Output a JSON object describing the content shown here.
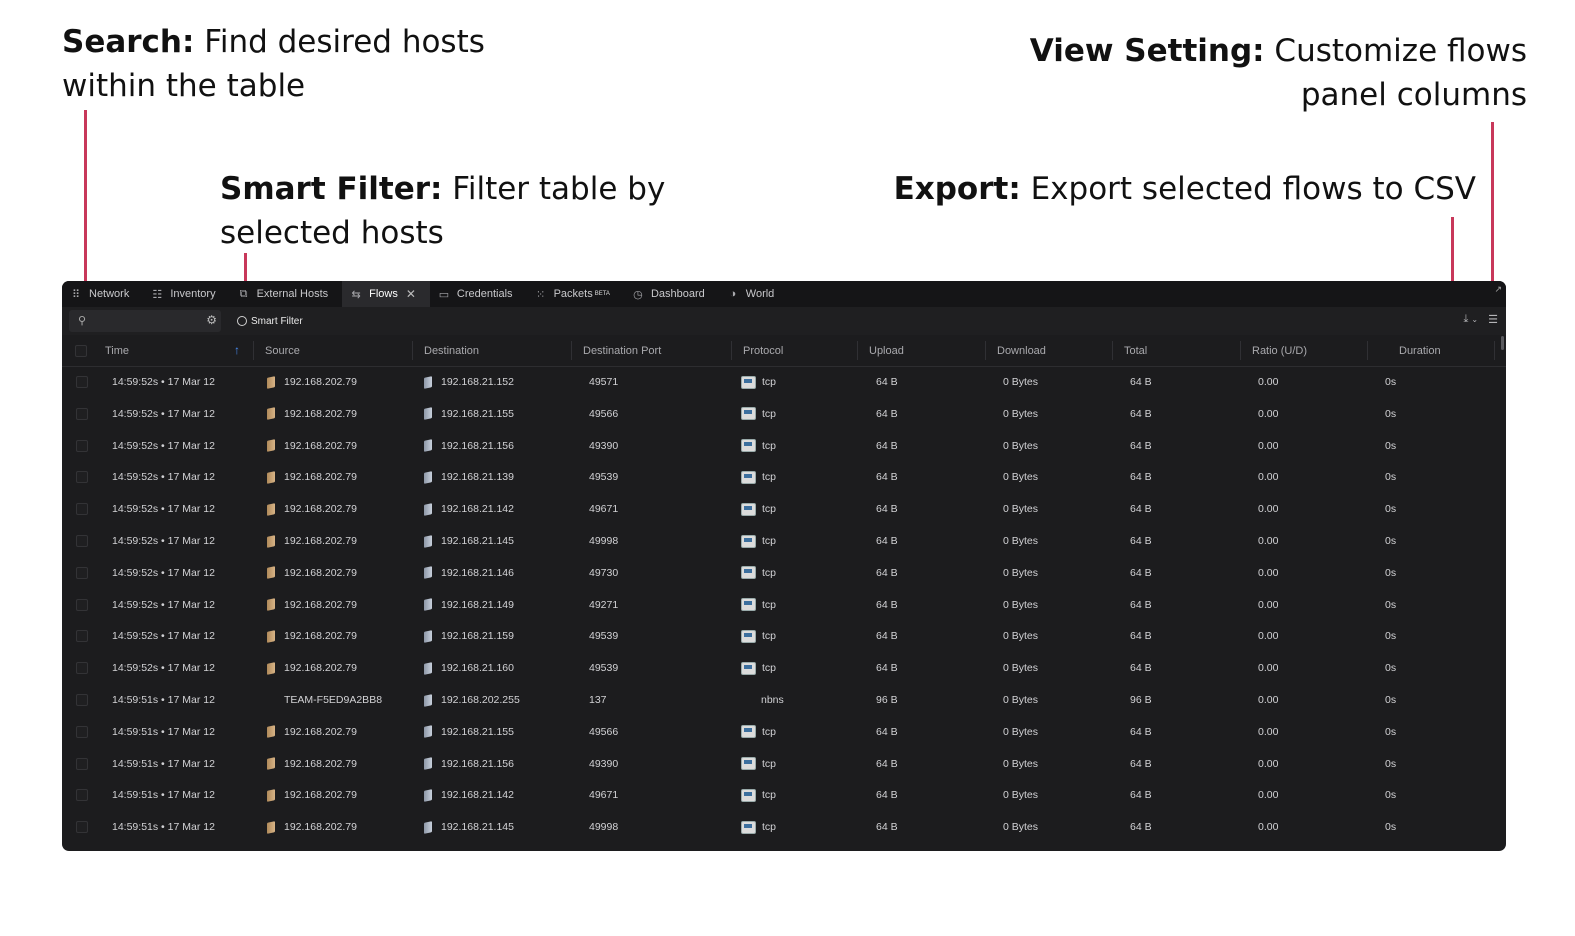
{
  "callouts": {
    "search": {
      "title": "Search:",
      "text": "Find desired hosts",
      "text2": "within the table"
    },
    "smart_filter": {
      "title": "Smart Filter:",
      "text": "Filter table by",
      "text2": "selected hosts"
    },
    "view_setting": {
      "title": "View Setting:",
      "text": "Customize flows",
      "text2": "panel columns"
    },
    "export": {
      "title": "Export:",
      "text": "Export selected flows to CSV"
    }
  },
  "tabs": [
    {
      "label": "Network",
      "icon": "network-icon",
      "glyph": "⠿"
    },
    {
      "label": "Inventory",
      "icon": "inventory-icon",
      "glyph": "☷"
    },
    {
      "label": "External Hosts",
      "icon": "external-hosts-icon",
      "glyph": "⧉"
    },
    {
      "label": "Flows",
      "icon": "flows-icon",
      "glyph": "⇆",
      "active": true
    },
    {
      "label": "Credentials",
      "icon": "credentials-icon",
      "glyph": "▭"
    },
    {
      "label": "Packets",
      "icon": "packets-icon",
      "glyph": "⁙",
      "badge": "BETA"
    },
    {
      "label": "Dashboard",
      "icon": "dashboard-icon",
      "glyph": "◷"
    },
    {
      "label": "World",
      "icon": "world-icon",
      "glyph": "◑"
    }
  ],
  "toolbar": {
    "search_placeholder": "",
    "smart_filter_label": "Smart Filter"
  },
  "columns": [
    "Time",
    "Source",
    "Destination",
    "Destination Port",
    "Protocol",
    "Upload",
    "Download",
    "Total",
    "Ratio (U/D)",
    "Duration"
  ],
  "rows": [
    {
      "time": "14:59:52s • 17 Mar 12",
      "source": "192.168.202.79",
      "destination": "192.168.21.152",
      "port": "49571",
      "protocol": "tcp",
      "upload": "64 B",
      "download": "0 Bytes",
      "total": "64 B",
      "ratio": "0.00",
      "duration": "0s"
    },
    {
      "time": "14:59:52s • 17 Mar 12",
      "source": "192.168.202.79",
      "destination": "192.168.21.155",
      "port": "49566",
      "protocol": "tcp",
      "upload": "64 B",
      "download": "0 Bytes",
      "total": "64 B",
      "ratio": "0.00",
      "duration": "0s"
    },
    {
      "time": "14:59:52s • 17 Mar 12",
      "source": "192.168.202.79",
      "destination": "192.168.21.156",
      "port": "49390",
      "protocol": "tcp",
      "upload": "64 B",
      "download": "0 Bytes",
      "total": "64 B",
      "ratio": "0.00",
      "duration": "0s"
    },
    {
      "time": "14:59:52s • 17 Mar 12",
      "source": "192.168.202.79",
      "destination": "192.168.21.139",
      "port": "49539",
      "protocol": "tcp",
      "upload": "64 B",
      "download": "0 Bytes",
      "total": "64 B",
      "ratio": "0.00",
      "duration": "0s"
    },
    {
      "time": "14:59:52s • 17 Mar 12",
      "source": "192.168.202.79",
      "destination": "192.168.21.142",
      "port": "49671",
      "protocol": "tcp",
      "upload": "64 B",
      "download": "0 Bytes",
      "total": "64 B",
      "ratio": "0.00",
      "duration": "0s"
    },
    {
      "time": "14:59:52s • 17 Mar 12",
      "source": "192.168.202.79",
      "destination": "192.168.21.145",
      "port": "49998",
      "protocol": "tcp",
      "upload": "64 B",
      "download": "0 Bytes",
      "total": "64 B",
      "ratio": "0.00",
      "duration": "0s"
    },
    {
      "time": "14:59:52s • 17 Mar 12",
      "source": "192.168.202.79",
      "destination": "192.168.21.146",
      "port": "49730",
      "protocol": "tcp",
      "upload": "64 B",
      "download": "0 Bytes",
      "total": "64 B",
      "ratio": "0.00",
      "duration": "0s"
    },
    {
      "time": "14:59:52s • 17 Mar 12",
      "source": "192.168.202.79",
      "destination": "192.168.21.149",
      "port": "49271",
      "protocol": "tcp",
      "upload": "64 B",
      "download": "0 Bytes",
      "total": "64 B",
      "ratio": "0.00",
      "duration": "0s"
    },
    {
      "time": "14:59:52s • 17 Mar 12",
      "source": "192.168.202.79",
      "destination": "192.168.21.159",
      "port": "49539",
      "protocol": "tcp",
      "upload": "64 B",
      "download": "0 Bytes",
      "total": "64 B",
      "ratio": "0.00",
      "duration": "0s"
    },
    {
      "time": "14:59:52s • 17 Mar 12",
      "source": "192.168.202.79",
      "destination": "192.168.21.160",
      "port": "49539",
      "protocol": "tcp",
      "upload": "64 B",
      "download": "0 Bytes",
      "total": "64 B",
      "ratio": "0.00",
      "duration": "0s"
    },
    {
      "time": "14:59:51s • 17 Mar 12",
      "source": "TEAM-F5ED9A2BB8",
      "destination": "192.168.202.255",
      "port": "137",
      "protocol": "nbns",
      "upload": "96 B",
      "download": "0 Bytes",
      "total": "96 B",
      "ratio": "0.00",
      "duration": "0s",
      "no_icons": true
    },
    {
      "time": "14:59:51s • 17 Mar 12",
      "source": "192.168.202.79",
      "destination": "192.168.21.155",
      "port": "49566",
      "protocol": "tcp",
      "upload": "64 B",
      "download": "0 Bytes",
      "total": "64 B",
      "ratio": "0.00",
      "duration": "0s"
    },
    {
      "time": "14:59:51s • 17 Mar 12",
      "source": "192.168.202.79",
      "destination": "192.168.21.156",
      "port": "49390",
      "protocol": "tcp",
      "upload": "64 B",
      "download": "0 Bytes",
      "total": "64 B",
      "ratio": "0.00",
      "duration": "0s"
    },
    {
      "time": "14:59:51s • 17 Mar 12",
      "source": "192.168.202.79",
      "destination": "192.168.21.142",
      "port": "49671",
      "protocol": "tcp",
      "upload": "64 B",
      "download": "0 Bytes",
      "total": "64 B",
      "ratio": "0.00",
      "duration": "0s"
    },
    {
      "time": "14:59:51s • 17 Mar 12",
      "source": "192.168.202.79",
      "destination": "192.168.21.145",
      "port": "49998",
      "protocol": "tcp",
      "upload": "64 B",
      "download": "0 Bytes",
      "total": "64 B",
      "ratio": "0.00",
      "duration": "0s"
    }
  ],
  "colors": {
    "leader": "#c8385a",
    "panel_bg": "#1c1c1e",
    "sort_accent": "#4a8cf0"
  }
}
